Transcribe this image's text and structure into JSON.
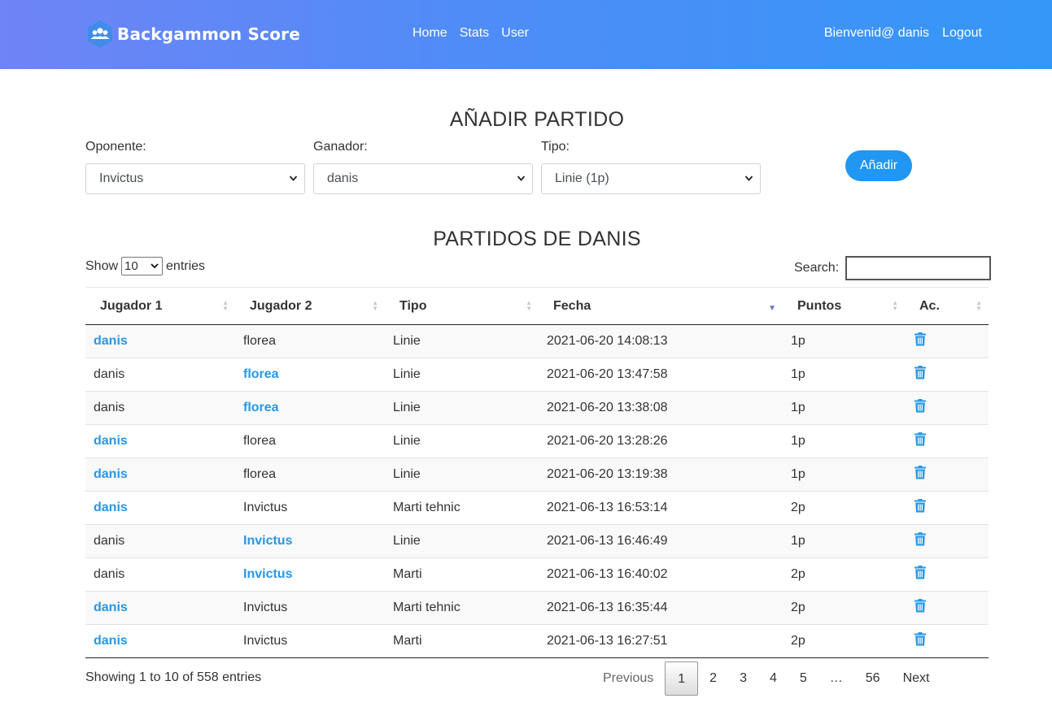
{
  "header": {
    "brand": "Backgammon Score",
    "nav": [
      "Home",
      "Stats",
      "User"
    ],
    "welcome": "Bienvenid@ danis",
    "logout": "Logout"
  },
  "add_form": {
    "title": "AÑADIR PARTIDO",
    "opponent_label": "Oponente:",
    "opponent_value": "Invictus",
    "winner_label": "Ganador:",
    "winner_value": "danis",
    "type_label": "Tipo:",
    "type_value": "Linie (1p)",
    "add_button": "Añadir"
  },
  "matches": {
    "title": "PARTIDOS DE DANIS",
    "show_label": "Show",
    "entries_label": "entries",
    "page_length": "10",
    "search_label": "Search:",
    "search_value": "",
    "columns": [
      "Jugador 1",
      "Jugador 2",
      "Tipo",
      "Fecha",
      "Puntos",
      "Ac."
    ],
    "sorted_column": "Fecha",
    "rows": [
      {
        "p1": "danis",
        "p2": "florea",
        "tipo": "Linie",
        "fecha": "2021-06-20 14:08:13",
        "puntos": "1p",
        "winner": "p1"
      },
      {
        "p1": "danis",
        "p2": "florea",
        "tipo": "Linie",
        "fecha": "2021-06-20 13:47:58",
        "puntos": "1p",
        "winner": "p2"
      },
      {
        "p1": "danis",
        "p2": "florea",
        "tipo": "Linie",
        "fecha": "2021-06-20 13:38:08",
        "puntos": "1p",
        "winner": "p2"
      },
      {
        "p1": "danis",
        "p2": "florea",
        "tipo": "Linie",
        "fecha": "2021-06-20 13:28:26",
        "puntos": "1p",
        "winner": "p1"
      },
      {
        "p1": "danis",
        "p2": "florea",
        "tipo": "Linie",
        "fecha": "2021-06-20 13:19:38",
        "puntos": "1p",
        "winner": "p1"
      },
      {
        "p1": "danis",
        "p2": "Invictus",
        "tipo": "Marti tehnic",
        "fecha": "2021-06-13 16:53:14",
        "puntos": "2p",
        "winner": "p1"
      },
      {
        "p1": "danis",
        "p2": "Invictus",
        "tipo": "Linie",
        "fecha": "2021-06-13 16:46:49",
        "puntos": "1p",
        "winner": "p2"
      },
      {
        "p1": "danis",
        "p2": "Invictus",
        "tipo": "Marti",
        "fecha": "2021-06-13 16:40:02",
        "puntos": "2p",
        "winner": "p2"
      },
      {
        "p1": "danis",
        "p2": "Invictus",
        "tipo": "Marti tehnic",
        "fecha": "2021-06-13 16:35:44",
        "puntos": "2p",
        "winner": "p1"
      },
      {
        "p1": "danis",
        "p2": "Invictus",
        "tipo": "Marti",
        "fecha": "2021-06-13 16:27:51",
        "puntos": "2p",
        "winner": "p1"
      }
    ],
    "info": "Showing 1 to 10 of 558 entries",
    "pagination": {
      "previous": "Previous",
      "pages": [
        "1",
        "2",
        "3",
        "4",
        "5",
        "…",
        "56"
      ],
      "current": "1",
      "next": "Next"
    }
  },
  "icons": {
    "brand": "people-group-icon",
    "delete": "trash-icon",
    "select": "chevron-down-icon"
  },
  "colors": {
    "header_start": "#6f84f6",
    "header_end": "#3497f8",
    "accent": "#1f97f3",
    "winner_text": "#2697e6"
  }
}
